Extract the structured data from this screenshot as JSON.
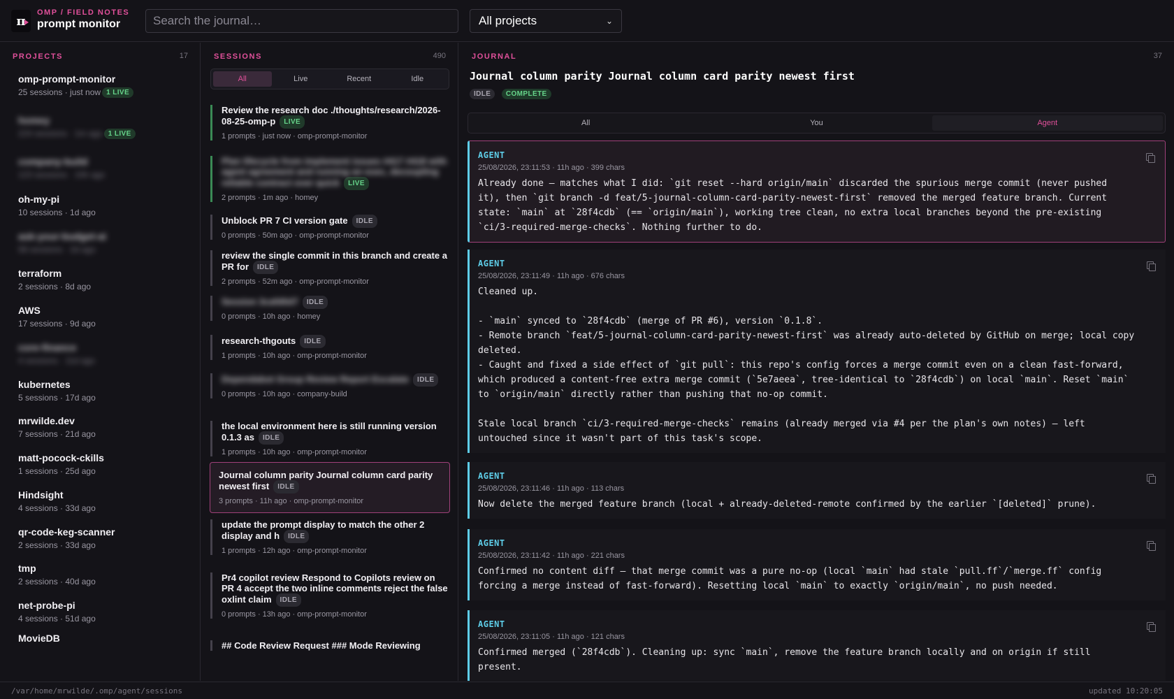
{
  "brand": {
    "kicker": "OMP / FIELD NOTES",
    "name": "prompt monitor",
    "logo": "π"
  },
  "search": {
    "placeholder": "Search the journal…"
  },
  "project_filter": {
    "selected": "All projects"
  },
  "projects": {
    "heading": "PROJECTS",
    "count": "17",
    "items": [
      {
        "name": "omp-prompt-monitor",
        "meta": "25 sessions · just now",
        "badge": "1 LIVE"
      },
      {
        "name": "homey",
        "meta": "224 sessions · 1m ago",
        "badge": "1 LIVE",
        "redacted": true
      },
      {
        "name": "company-build",
        "meta": "123 sessions · 10h ago",
        "redacted": true
      },
      {
        "name": "oh-my-pi",
        "meta": "10 sessions · 1d ago"
      },
      {
        "name": "ask-your-budget-ai",
        "meta": "58 sessions · 2d ago",
        "redacted": true
      },
      {
        "name": "terraform",
        "meta": "2 sessions · 8d ago"
      },
      {
        "name": "AWS",
        "meta": "17 sessions · 9d ago"
      },
      {
        "name": "core-finance",
        "meta": "4 sessions · 11d ago",
        "redacted": true
      },
      {
        "name": "kubernetes",
        "meta": "5 sessions · 17d ago"
      },
      {
        "name": "mrwilde.dev",
        "meta": "7 sessions · 21d ago"
      },
      {
        "name": "matt-pocock-ckills",
        "meta": "1 sessions · 25d ago"
      },
      {
        "name": "Hindsight",
        "meta": "4 sessions · 33d ago"
      },
      {
        "name": "qr-code-keg-scanner",
        "meta": "2 sessions · 33d ago"
      },
      {
        "name": "tmp",
        "meta": "2 sessions · 40d ago"
      },
      {
        "name": "net-probe-pi",
        "meta": "4 sessions · 51d ago"
      },
      {
        "name": "MovieDB",
        "meta": ""
      }
    ]
  },
  "sessions": {
    "heading": "SESSIONS",
    "count": "490",
    "filters": [
      "All",
      "Live",
      "Recent",
      "Idle"
    ],
    "active_filter": "All",
    "items": [
      {
        "title": "Review the research doc ./thoughts/research/2026-08-25-omp-p",
        "badge": "LIVE",
        "meta": "1 prompts · just now · omp-prompt-monitor",
        "state": "live"
      },
      {
        "title": "Plan lifecycle from implement issues #417 #418 with agent agreement and running an exec, decoupling reliable contract over quick",
        "badge": "LIVE",
        "meta": "2 prompts · 1m ago · homey",
        "state": "live",
        "redacted": true
      },
      {
        "title": "Unblock PR 7 CI version gate",
        "badge": "IDLE",
        "meta": "0 prompts · 50m ago · omp-prompt-monitor",
        "state": "idle"
      },
      {
        "title": "review the single commit in this branch and create a PR for",
        "badge": "IDLE",
        "meta": "2 prompts · 52m ago · omp-prompt-monitor",
        "state": "idle"
      },
      {
        "title": "Session 3cafd0d7",
        "badge": "IDLE",
        "meta": "0 prompts · 10h ago · homey",
        "state": "idle",
        "redacted": true
      },
      {
        "title": "research-thgouts",
        "badge": "IDLE",
        "meta": "1 prompts · 10h ago · omp-prompt-monitor",
        "state": "idle"
      },
      {
        "title": "Dependabot Group Review Report Escalate",
        "badge": "IDLE",
        "meta": "0 prompts · 10h ago · company-build",
        "state": "idle",
        "redacted": true
      },
      {
        "title": "the local environment here is still running version 0.1.3 as",
        "badge": "IDLE",
        "meta": "1 prompts · 10h ago · omp-prompt-monitor",
        "state": "idle"
      },
      {
        "title": "Journal column parity Journal column card parity newest first",
        "badge": "IDLE",
        "meta": "3 prompts · 11h ago · omp-prompt-monitor",
        "state": "active"
      },
      {
        "title": "update the prompt display to match the other 2 display and h",
        "badge": "IDLE",
        "meta": "1 prompts · 12h ago · omp-prompt-monitor",
        "state": "idle"
      },
      {
        "title": "Pr4 copilot review Respond to Copilots review on PR 4 accept the two inline comments reject the false oxlint claim",
        "badge": "IDLE",
        "meta": "0 prompts · 13h ago · omp-prompt-monitor",
        "state": "idle"
      },
      {
        "title": "## Code Review Request ### Mode Reviewing",
        "badge": "",
        "meta": "",
        "state": "idle"
      }
    ]
  },
  "journal": {
    "heading": "JOURNAL",
    "count": "37",
    "title": "Journal column parity Journal column card parity newest first",
    "status_badges": [
      "IDLE",
      "COMPLETE"
    ],
    "tabs": [
      "All",
      "You",
      "Agent"
    ],
    "active_tab": "Agent",
    "entries": [
      {
        "label": "AGENT",
        "meta": "25/08/2026, 23:11:53 · 11h ago · 399 chars",
        "body": "Already done — matches what I did: `git reset --hard origin/main` discarded the spurious merge commit (never pushed it), then `git branch -d feat/5-journal-column-card-parity-newest-first` removed the merged feature branch. Current state: `main` at `28f4cdb` (== `origin/main`), working tree clean, no extra local branches beyond the pre-existing `ci/3-required-merge-checks`. Nothing further to do.",
        "selected": true
      },
      {
        "label": "AGENT",
        "meta": "25/08/2026, 23:11:49 · 11h ago · 676 chars",
        "body": "Cleaned up.\n\n- `main` synced to `28f4cdb` (merge of PR #6), version `0.1.8`.\n- Remote branch `feat/5-journal-column-card-parity-newest-first` was already auto-deleted by GitHub on merge; local copy deleted.\n- Caught and fixed a side effect of `git pull`: this repo's config forces a merge commit even on a clean fast-forward, which produced a content-free extra merge commit (`5e7aeea`, tree-identical to `28f4cdb`) on local `main`. Reset `main` to `origin/main` directly rather than pushing that no-op commit.\n\nStale local branch `ci/3-required-merge-checks` remains (already merged via #4 per the plan's own notes) — left untouched since it wasn't part of this task's scope."
      },
      {
        "label": "AGENT",
        "meta": "25/08/2026, 23:11:46 · 11h ago · 113 chars",
        "body": "Now delete the merged feature branch (local + already-deleted-remote confirmed by the earlier `[deleted]` prune)."
      },
      {
        "label": "AGENT",
        "meta": "25/08/2026, 23:11:42 · 11h ago · 221 chars",
        "body": "Confirmed no content diff — that merge commit was a pure no-op (local `main` had stale `pull.ff`/`merge.ff` config forcing a merge instead of fast-forward). Resetting local `main` to exactly `origin/main`, no push needed."
      },
      {
        "label": "AGENT",
        "meta": "25/08/2026, 23:11:05 · 11h ago · 121 chars",
        "body": "Confirmed merged (`28f4cdb`). Cleaning up: sync `main`, remove the feature branch locally and on origin if still present."
      }
    ]
  },
  "footer": {
    "path": "/var/home/mrwilde/.omp/agent/sessions",
    "updated": "updated 10:20:05"
  },
  "colors": {
    "accent": "#e0509a",
    "agent": "#5ecde8",
    "live": "#66d48a",
    "background": "#141318"
  }
}
